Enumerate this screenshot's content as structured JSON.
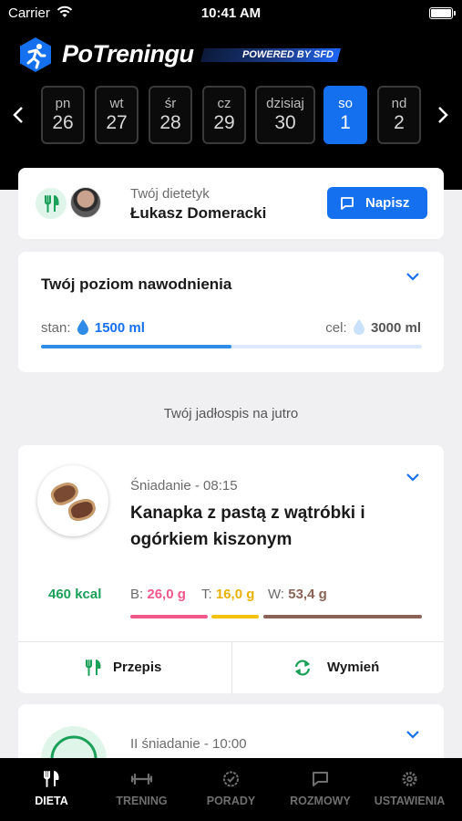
{
  "status_bar": {
    "carrier": "Carrier",
    "time": "10:41 AM"
  },
  "header": {
    "brand": "PoTreningu",
    "powered_by": "POWERED BY SFD"
  },
  "calendar": {
    "days": [
      {
        "name": "pn",
        "num": "26"
      },
      {
        "name": "wt",
        "num": "27"
      },
      {
        "name": "śr",
        "num": "28"
      },
      {
        "name": "cz",
        "num": "29"
      },
      {
        "name": "dzisiaj",
        "num": "30"
      },
      {
        "name": "so",
        "num": "1",
        "selected": true
      },
      {
        "name": "nd",
        "num": "2"
      }
    ]
  },
  "dietitian": {
    "label": "Twój dietetyk",
    "name": "Łukasz Domeracki",
    "button": "Napisz"
  },
  "hydration": {
    "title": "Twój poziom nawodnienia",
    "current_label": "stan:",
    "current_value": "1500 ml",
    "goal_label": "cel:",
    "goal_value": "3000 ml",
    "progress": 0.5
  },
  "menu_title": "Twój jadłospis na jutro",
  "meals": [
    {
      "time": "Śniadanie - 08:15",
      "title": "Kanapka z pastą z wątróbki i ogórkiem kiszonym",
      "kcal": "460 kcal",
      "b_label": "B:",
      "b_value": "26,0 g",
      "t_label": "T:",
      "t_value": "16,0 g",
      "w_label": "W:",
      "w_value": "53,4 g",
      "recipe": "Przepis",
      "swap": "Wymień"
    },
    {
      "time": "II śniadanie - 10:00"
    }
  ],
  "colors": {
    "accent": "#1570ef",
    "protein": "#f0588a",
    "fat": "#f4c20d",
    "carbs": "#8b6356",
    "kcal": "#1aa058"
  },
  "tabbar": [
    {
      "label": "DIETA",
      "icon": "fork-knife-icon",
      "active": true
    },
    {
      "label": "TRENING",
      "icon": "dumbbell-icon"
    },
    {
      "label": "PORADY",
      "icon": "badge-check-icon"
    },
    {
      "label": "ROZMOWY",
      "icon": "chat-icon"
    },
    {
      "label": "USTAWIENIA",
      "icon": "gear-icon"
    }
  ]
}
